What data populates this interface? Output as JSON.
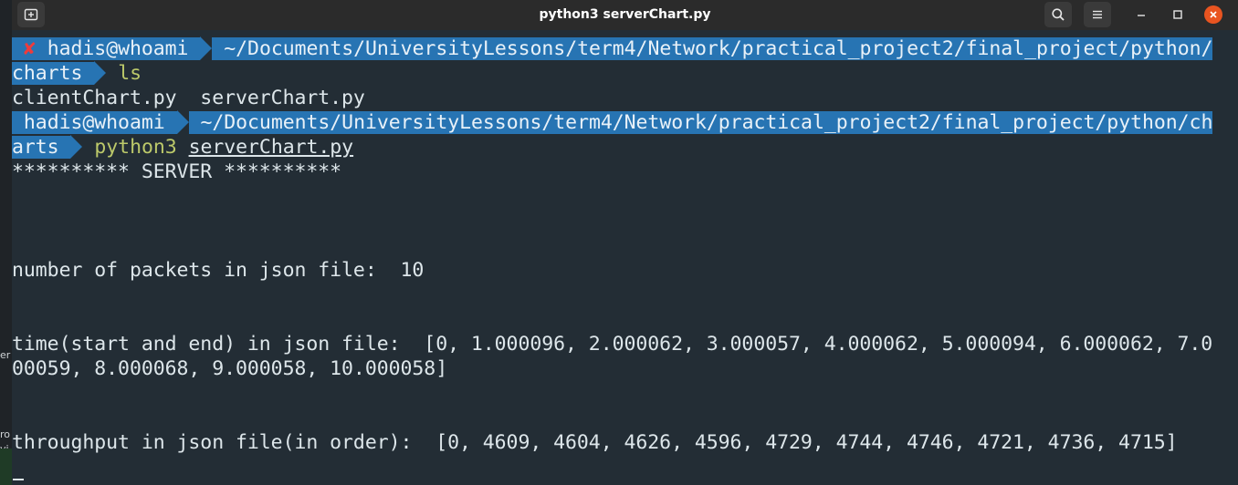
{
  "window": {
    "title": "python3 serverChart.py"
  },
  "icons": {
    "new_tab": "new-tab-icon",
    "search": "search-icon",
    "menu": "hamburger-menu-icon",
    "minimize": "minimize-icon",
    "maximize": "maximize-icon",
    "close": "close-icon",
    "error": "cross-error-icon"
  },
  "colors": {
    "terminal_bg": "#232d35",
    "prompt_highlight": "#2774b3",
    "command": "#bcc96a",
    "error_mark": "#ef3b3b",
    "close_button": "#e95420"
  },
  "desktop_fragments": [
    "er",
    "ro",
    "vi"
  ],
  "terminal": {
    "prompt1": {
      "error_mark": "✘",
      "user": "hadis@whoami",
      "path_line1": "~/Documents/UniversityLessons/term4/Network/practical_project2/final_project/python/",
      "path_line2": "charts",
      "command": "ls"
    },
    "ls_output": "clientChart.py  serverChart.py",
    "prompt2": {
      "user": "hadis@whoami",
      "path_line1": "~/Documents/UniversityLessons/term4/Network/practical_project2/final_project/python/ch",
      "path_line2": "arts",
      "command": "python3",
      "argument": "serverChart.py"
    },
    "server_banner": "********** SERVER **********",
    "packets_line": "number of packets in json file:  10",
    "time_line1": "time(start and end) in json file:  [0, 1.000096, 2.000062, 3.000057, 4.000062, 5.000094, 6.000062, 7.0",
    "time_line2": "00059, 8.000068, 9.000058, 10.000058]",
    "throughput_line": "throughput in json file(in order):  [0, 4609, 4604, 4626, 4596, 4729, 4744, 4746, 4721, 4736, 4715]"
  }
}
